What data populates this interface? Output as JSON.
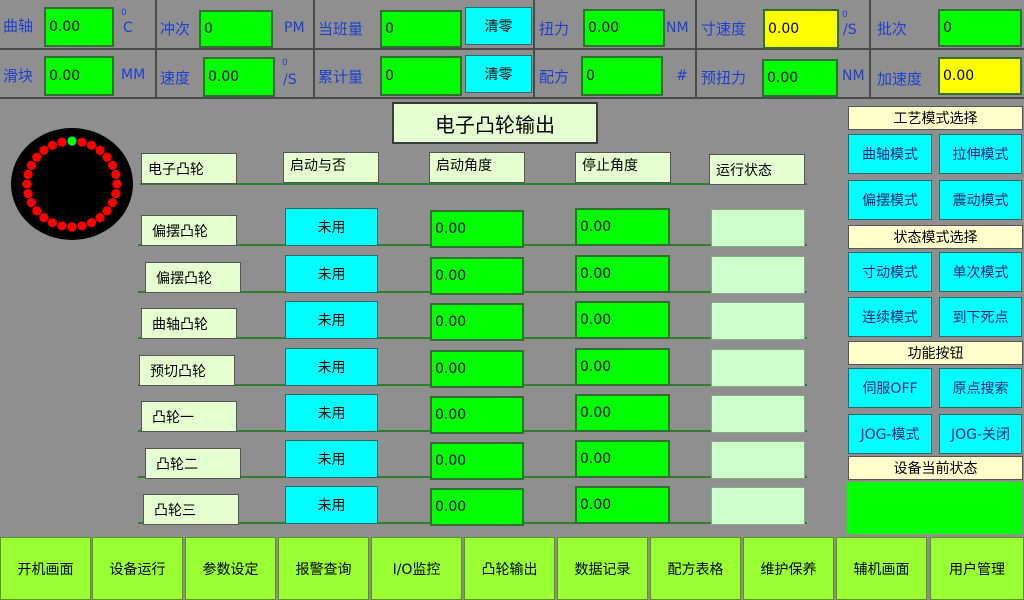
{
  "top": {
    "crank_label": "曲轴",
    "crank_value": "0.00",
    "crank_sup": "0",
    "crank_unit": "C",
    "stroke_label": "冲次",
    "stroke_value": "0",
    "stroke_unit": "PM",
    "shift_label": "当班量",
    "shift_value": "0",
    "shift_clear": "清零",
    "torque_label": "扭力",
    "torque_value": "0.00",
    "torque_unit": "NM",
    "inch_speed_label": "寸速度",
    "inch_speed_value": "0.00",
    "inch_speed_sup": "0",
    "inch_speed_unit": "/S",
    "batch_label": "批次",
    "batch_value": "0",
    "slider_label": "滑块",
    "slider_value": "0.00",
    "slider_unit": "MM",
    "speed_label": "速度",
    "speed_value": "0.00",
    "speed_sup": "0",
    "speed_unit": "/S",
    "total_label": "累计量",
    "total_value": "0",
    "total_clear": "清零",
    "recipe_label": "配方",
    "recipe_value": "0",
    "recipe_unit": "#",
    "pretorque_label": "预扭力",
    "pretorque_value": "0.00",
    "pretorque_unit": "NM",
    "accel_label": "加速度",
    "accel_value": "0.00"
  },
  "main": {
    "title": "电子凸轮输出",
    "headers": {
      "cam": "电子凸轮",
      "enable": "启动与否",
      "start": "启动角度",
      "stop": "停止角度",
      "state": "运行状态"
    },
    "rows": [
      {
        "name": "偏摆凸轮",
        "enable": "未用",
        "start": "0.00",
        "stop": "0.00"
      },
      {
        "name": "偏摆凸轮",
        "enable": "未用",
        "start": "0.00",
        "stop": "0.00"
      },
      {
        "name": "曲轴凸轮",
        "enable": "未用",
        "start": "0.00",
        "stop": "0.00"
      },
      {
        "name": "预切凸轮",
        "enable": "未用",
        "start": "0.00",
        "stop": "0.00"
      },
      {
        "name": "凸轮一",
        "enable": "未用",
        "start": "0.00",
        "stop": "0.00"
      },
      {
        "name": "凸轮二",
        "enable": "未用",
        "start": "0.00",
        "stop": "0.00"
      },
      {
        "name": "凸轮三",
        "enable": "未用",
        "start": "0.00",
        "stop": "0.00"
      }
    ]
  },
  "side": {
    "process_header": "工艺模式选择",
    "process": [
      "曲轴模式",
      "拉伸模式",
      "偏摆模式",
      "震动模式"
    ],
    "status_header": "状态模式选择",
    "status": [
      "寸动模式",
      "单次模式",
      "连续模式",
      "到下死点"
    ],
    "function_header": "功能按钮",
    "function": [
      "伺服OFF",
      "原点搜索",
      "JOG-模式",
      "JOG-关闭"
    ],
    "device_header": "设备当前状态"
  },
  "nav": [
    "开机画面",
    "设备运行",
    "参数设定",
    "报警查询",
    "I/O监控",
    "凸轮输出",
    "数据记录",
    "配方表格",
    "维护保养",
    "辅机画面",
    "用户管理"
  ],
  "colors": {
    "background": "#8f8f8f",
    "value_field": "#00ff00",
    "highlight_field": "#ffff00",
    "button": "#00ffff",
    "nav": "#99ff33",
    "indicator_dot": "#ff0000",
    "indicator_active": "#00ff00"
  }
}
